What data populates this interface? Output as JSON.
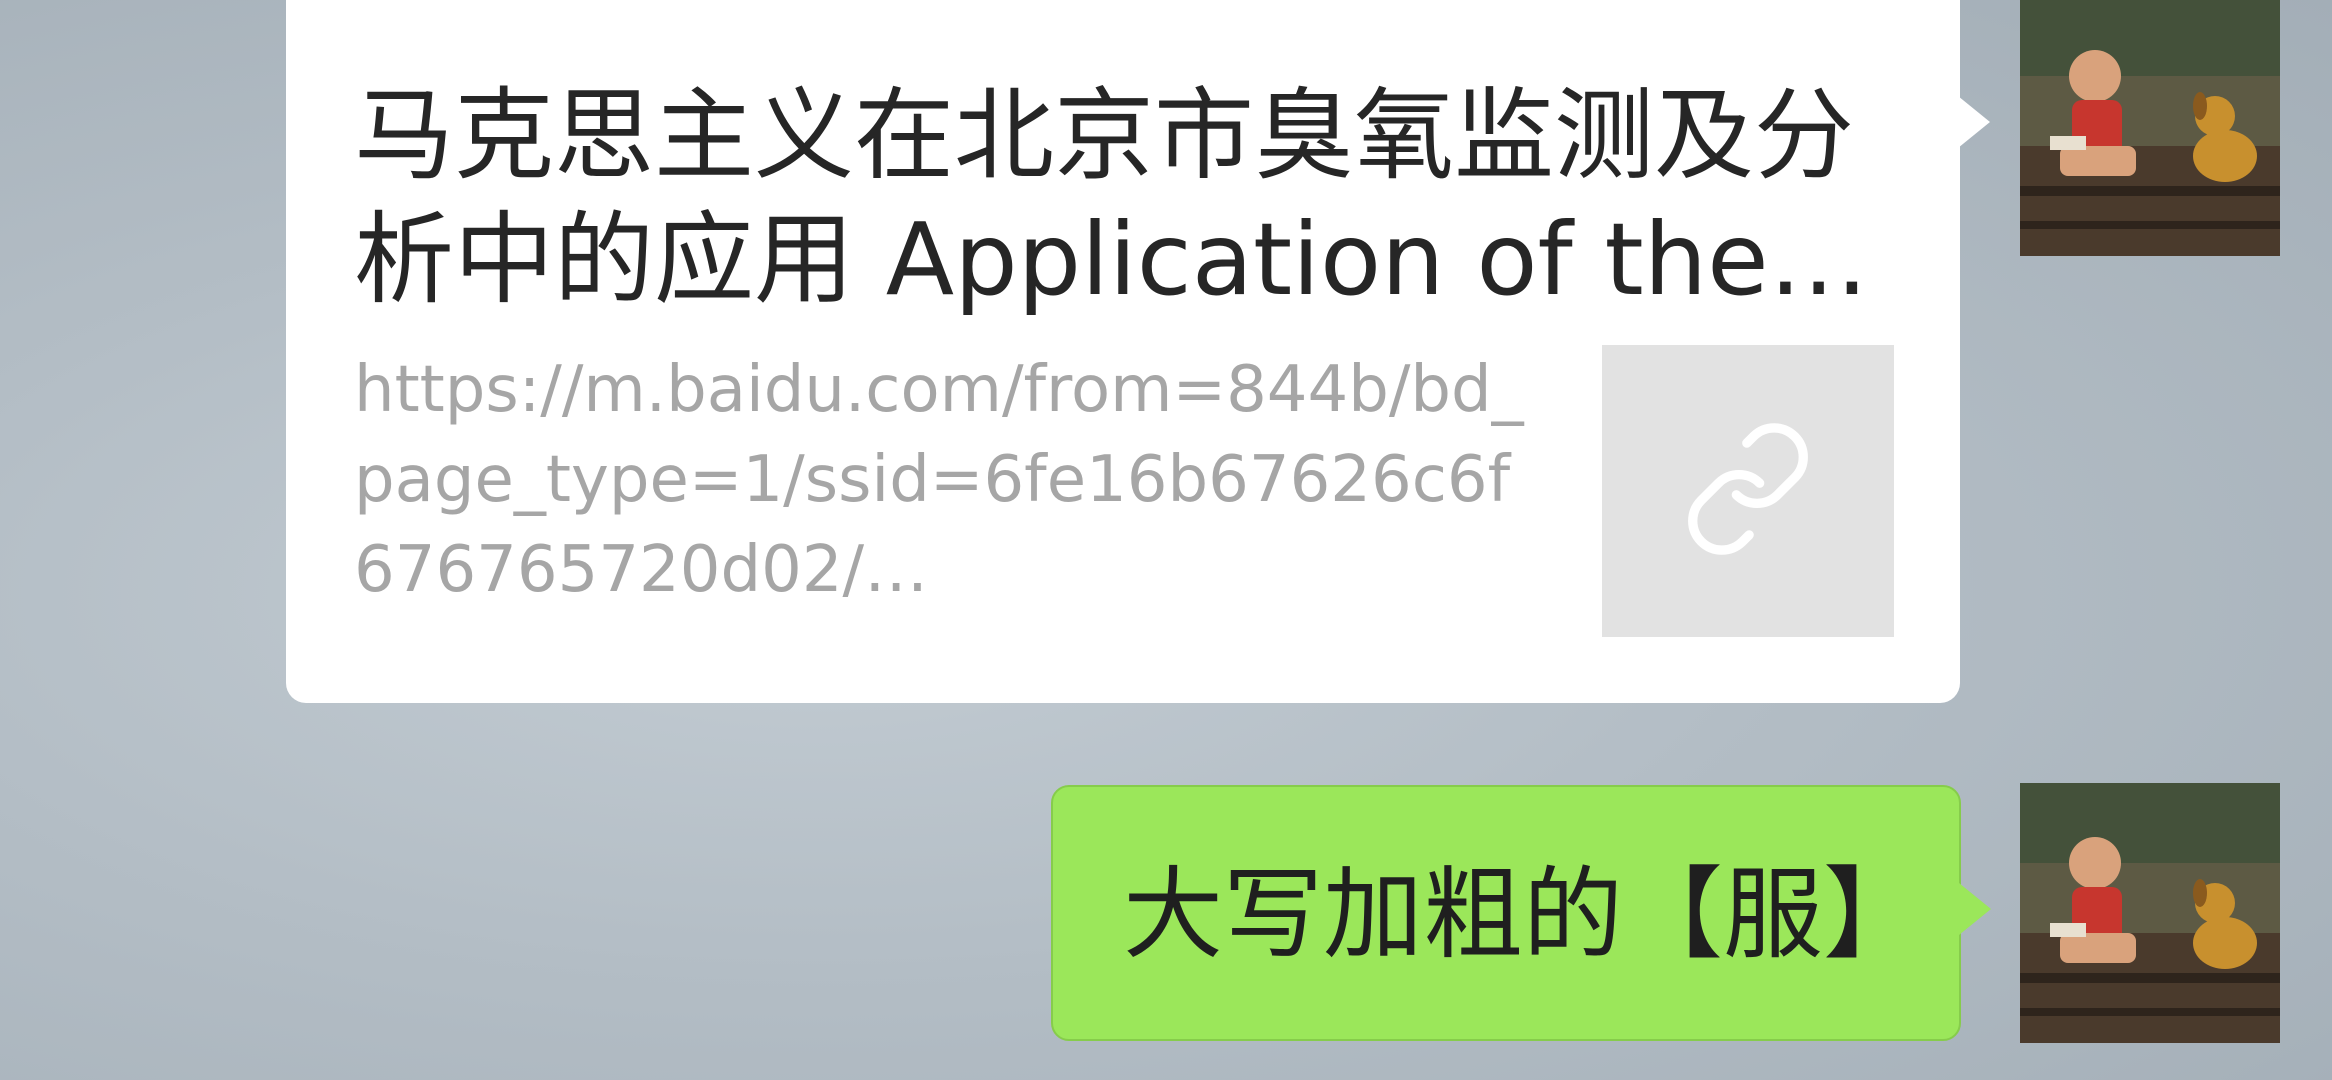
{
  "messages": [
    {
      "type": "link",
      "direction": "outgoing",
      "title": "马克思主义在北京市臭氧监测及分析中的应用 Application of the…",
      "url": "https://m.baidu.com/from=844b/bd_page_type=1/ssid=6fe16b67626c6f676765720d02/…",
      "thumbnail_icon": "link-icon"
    },
    {
      "type": "text",
      "direction": "outgoing",
      "text": "大写加粗的【服】"
    }
  ],
  "colors": {
    "link_bubble_bg": "#ffffff",
    "text_bubble_bg": "#9be75a",
    "url_text": "#a6a6a6",
    "thumbnail_bg": "#e2e2e2"
  }
}
